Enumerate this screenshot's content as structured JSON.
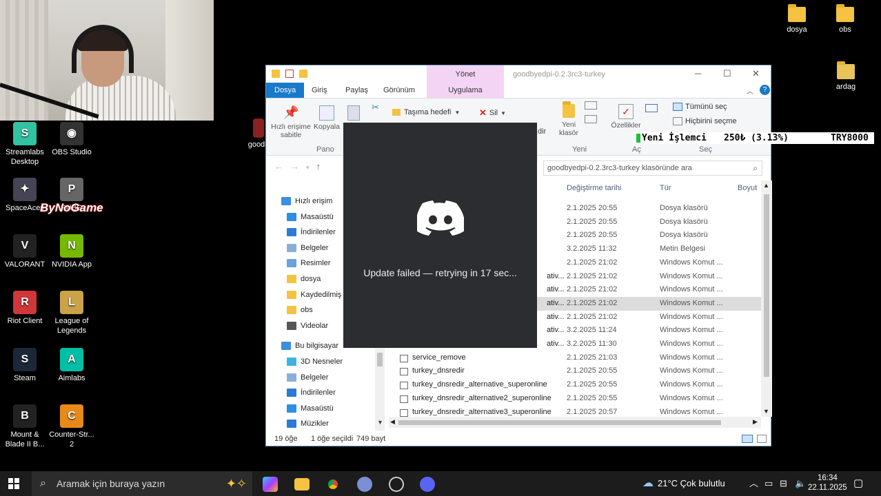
{
  "desktop": {
    "icons_left": [
      {
        "label": "Streamlabs Desktop",
        "color": "#31c3a2",
        "glyph": "S"
      },
      {
        "label": "OBS Studio",
        "color": "#333",
        "glyph": "◉"
      },
      {
        "label": "SpaceAces",
        "color": "#445",
        "glyph": "✦"
      },
      {
        "label": "PUBG",
        "color": "#666",
        "glyph": "P"
      },
      {
        "label": "VALORANT",
        "color": "#222",
        "glyph": "V"
      },
      {
        "label": "NVIDIA App",
        "color": "#76b900",
        "glyph": "N"
      },
      {
        "label": "Riot Client",
        "color": "#d13639",
        "glyph": "R"
      },
      {
        "label": "League of Legends",
        "color": "#c9a24a",
        "glyph": "L"
      },
      {
        "label": "Steam",
        "color": "#1b2838",
        "glyph": "S"
      },
      {
        "label": "Aimlabs",
        "color": "#00bfa5",
        "glyph": "A"
      },
      {
        "label": "Mount & Blade II B...",
        "color": "#222",
        "glyph": "B"
      },
      {
        "label": "Counter-Str... 2",
        "color": "#e88a1a",
        "glyph": "C"
      }
    ],
    "partial_icon_label": "goodb",
    "bynogame_text": "ByNoGame",
    "icons_right": [
      {
        "label": "dosya"
      },
      {
        "label": "obs"
      },
      {
        "label": "ardag"
      }
    ]
  },
  "explorer": {
    "title": "goodbyedpi-0.2.3rc3-turkey",
    "yonet_label": "Yönet",
    "ribbon_tabs": [
      "Dosya",
      "Giriş",
      "Paylaş",
      "Görünüm",
      "Uygulama Araçları"
    ],
    "ribbon": {
      "pin_label": "Hızlı erişime sabitle",
      "copy_label": "Kopyala",
      "group_pano": "Pano",
      "move_label": "Taşıma hedefi",
      "delete_label": "Sil",
      "partial_dir": "dir",
      "new_folder_label": "Yeni klasör",
      "group_yeni": "Yeni",
      "props_label": "Özellikler",
      "group_ac": "Aç",
      "select_all": "Tümünü seç",
      "select_none": "Hiçbirini seçme",
      "group_sec": "Seç"
    },
    "search_placeholder": "goodbyedpi-0.2.3rc3-turkey klasöründe ara",
    "columns": {
      "date": "Değiştirme tarihi",
      "type": "Tür",
      "size": "Boyut"
    },
    "nav": [
      {
        "label": "Hızlı erişim",
        "icon": "star-icon",
        "color": "#3b8ee0",
        "indent": 0
      },
      {
        "label": "Masaüstü",
        "icon": "desktop-icon",
        "color": "#2d8fdf",
        "indent": 1
      },
      {
        "label": "İndirilenler",
        "icon": "download-icon",
        "color": "#2d7ad6",
        "indent": 1
      },
      {
        "label": "Belgeler",
        "icon": "document-icon",
        "color": "#8ab0d8",
        "indent": 1
      },
      {
        "label": "Resimler",
        "icon": "pictures-icon",
        "color": "#6aa3d8",
        "indent": 1
      },
      {
        "label": "dosya",
        "icon": "folder-icon",
        "color": "#f5c342",
        "indent": 1
      },
      {
        "label": "Kaydedilmiş",
        "icon": "folder-icon",
        "color": "#f5c342",
        "indent": 1
      },
      {
        "label": "obs",
        "icon": "folder-icon",
        "color": "#f5c342",
        "indent": 1
      },
      {
        "label": "Videolar",
        "icon": "video-icon",
        "color": "#555",
        "indent": 1
      },
      {
        "label": "Bu bilgisayar",
        "icon": "computer-icon",
        "color": "#3b8ee0",
        "indent": 0
      },
      {
        "label": "3D Nesneler",
        "icon": "cube-icon",
        "color": "#3bb4e0",
        "indent": 1
      },
      {
        "label": "Belgeler",
        "icon": "document-icon",
        "color": "#8ab0d8",
        "indent": 1
      },
      {
        "label": "İndirilenler",
        "icon": "download-icon",
        "color": "#2d7ad6",
        "indent": 1
      },
      {
        "label": "Masaüstü",
        "icon": "desktop-icon",
        "color": "#2d8fdf",
        "indent": 1
      },
      {
        "label": "Müzikler",
        "icon": "music-icon",
        "color": "#2d7ad6",
        "indent": 1
      }
    ],
    "files": [
      {
        "name": "",
        "date": "2.1.2025 20:55",
        "type": "Dosya klasörü"
      },
      {
        "name": "",
        "date": "2.1.2025 20:55",
        "type": "Dosya klasörü"
      },
      {
        "name": "",
        "date": "2.1.2025 20:55",
        "type": "Dosya klasörü"
      },
      {
        "name": "",
        "date": "3.2.2025 11:32",
        "type": "Metin Belgesi"
      },
      {
        "name": "",
        "date": "2.1.2025 21:02",
        "type": "Windows Komut ..."
      },
      {
        "name": "ativ...",
        "date": "2.1.2025 21:02",
        "type": "Windows Komut ..."
      },
      {
        "name": "ativ...",
        "date": "2.1.2025 21:02",
        "type": "Windows Komut ..."
      },
      {
        "name": "ativ...",
        "date": "2.1.2025 21:02",
        "type": "Windows Komut ...",
        "selected": true
      },
      {
        "name": "ativ...",
        "date": "2.1.2025 21:02",
        "type": "Windows Komut ..."
      },
      {
        "name": "ativ...",
        "date": "3.2.2025 11:24",
        "type": "Windows Komut ..."
      },
      {
        "name": "ativ...",
        "date": "3.2.2025 11:30",
        "type": "Windows Komut ..."
      },
      {
        "name": "service_remove",
        "date": "2.1.2025 21:03",
        "type": "Windows Komut ..."
      },
      {
        "name": "turkey_dnsredir",
        "date": "2.1.2025 20:55",
        "type": "Windows Komut ..."
      },
      {
        "name": "turkey_dnsredir_alternative_superonline",
        "date": "2.1.2025 20:55",
        "type": "Windows Komut ..."
      },
      {
        "name": "turkey_dnsredir_alternative2_superonline",
        "date": "2.1.2025 20:55",
        "type": "Windows Komut ..."
      },
      {
        "name": "turkey_dnsredir_alternative3_superonline",
        "date": "2.1.2025 20:57",
        "type": "Windows Komut ..."
      }
    ],
    "status": {
      "count": "19 öğe",
      "selected": "1 öğe seçildi",
      "size": "749 bayt"
    }
  },
  "discord": {
    "message": "Update failed — retrying in 17 sec...",
    "color": "#5865f2"
  },
  "ticker": {
    "name": "Yeni İşlemci",
    "price": "250₺ (3.13%)",
    "total": "TRY8000"
  },
  "taskbar": {
    "search_placeholder": "Aramak için buraya yazın",
    "weather": "21°C  Çok bulutlu",
    "time": "16:34",
    "date": "22.11.2025"
  }
}
